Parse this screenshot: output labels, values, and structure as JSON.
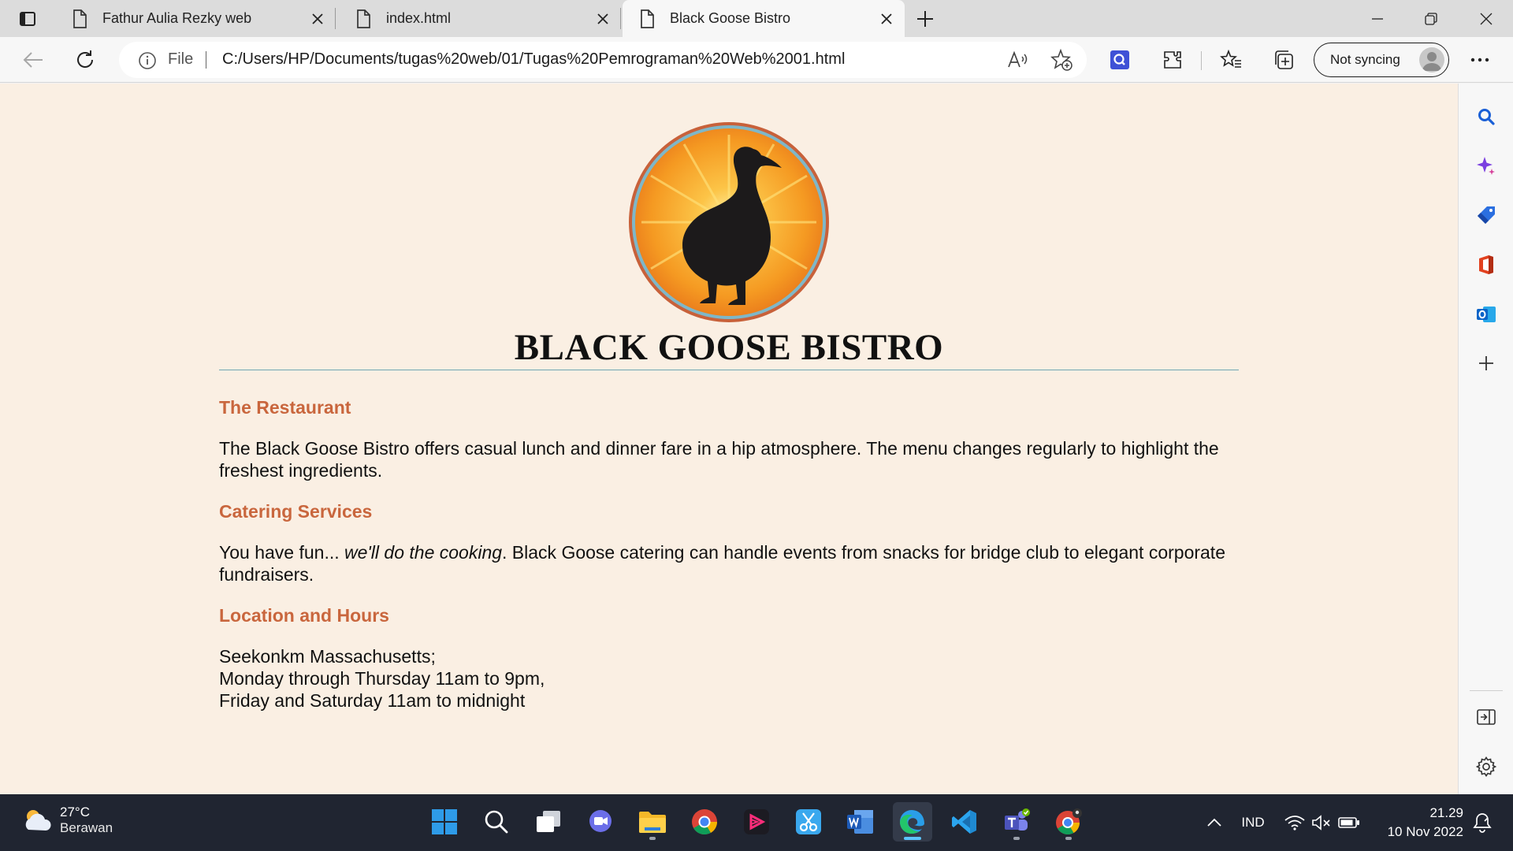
{
  "browser": {
    "tabs": [
      {
        "title": "Fathur Aulia Rezky web",
        "active": false
      },
      {
        "title": "index.html",
        "active": false
      },
      {
        "title": "Black Goose Bistro",
        "active": true
      }
    ],
    "address": {
      "scheme_label": "File",
      "url": "C:/Users/HP/Documents/tugas%20web/01/Tugas%20Pemrograman%20Web%2001.html"
    },
    "profile": {
      "sync_label": "Not syncing"
    }
  },
  "page": {
    "title": "BLACK GOOSE BISTRO",
    "sections": [
      {
        "heading": "The Restaurant",
        "text": "The Black Goose Bistro offers casual lunch and dinner fare in a hip atmosphere. The menu changes regularly to highlight the freshest ingredients."
      },
      {
        "heading": "Catering Services",
        "text_before": "You have fun... ",
        "text_emphasis": "we'll do the cooking",
        "text_after": ". Black Goose catering can handle events from snacks for bridge club to elegant corporate fundraisers."
      },
      {
        "heading": "Location and Hours",
        "lines": [
          "Seekonkm Massachusetts;",
          "Monday through Thursday 11am to 9pm,",
          "Friday and Saturday 11am to midnight"
        ]
      }
    ]
  },
  "taskbar": {
    "weather": {
      "temp": "27°C",
      "condition": "Berawan"
    },
    "language": "IND",
    "time": "21.29",
    "date": "10 Nov 2022"
  },
  "colors": {
    "page_background": "#faefe3",
    "heading_accent": "#c9663d",
    "rule": "#6fa7b3",
    "taskbar": "#202531"
  }
}
